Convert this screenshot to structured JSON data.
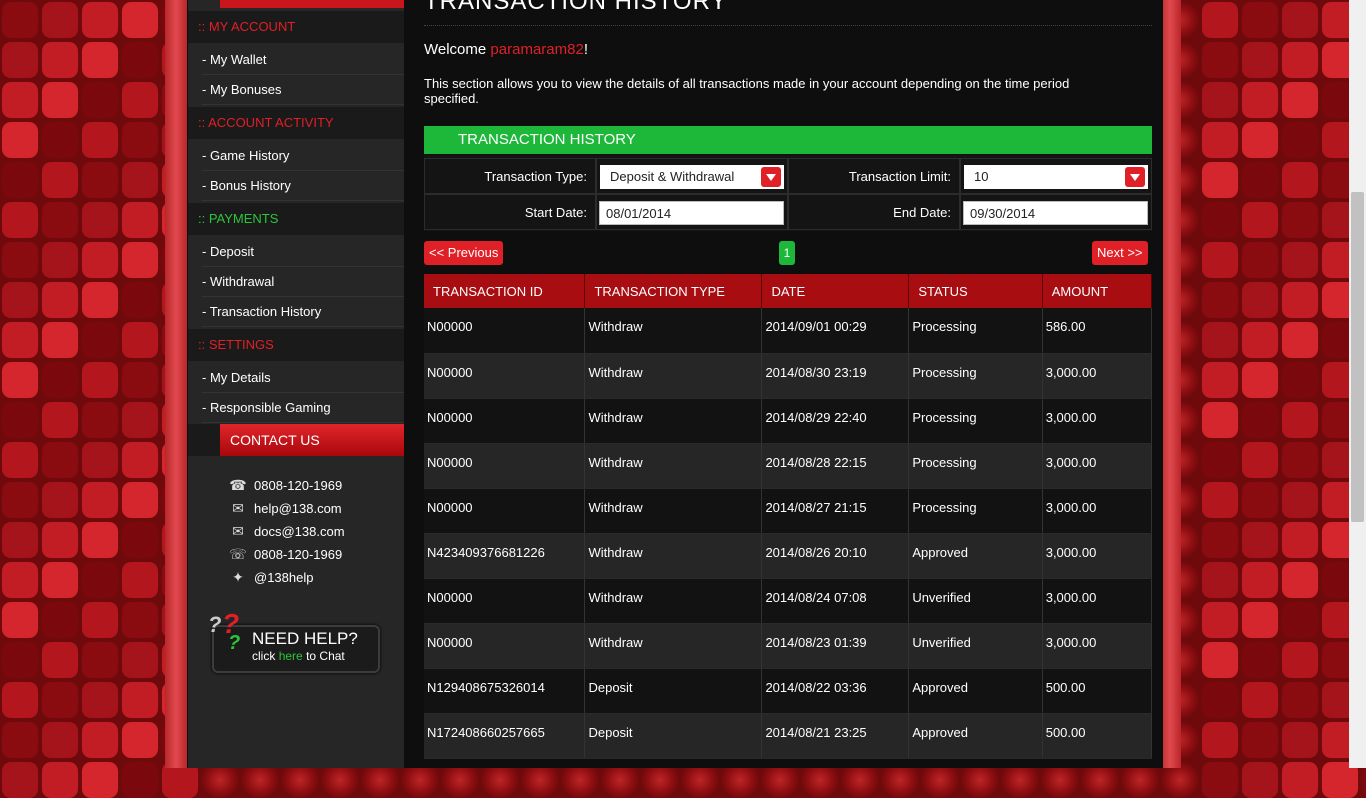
{
  "sidebar": {
    "sections": [
      {
        "title": ":: MY ACCOUNT",
        "items": [
          "- My Wallet",
          "- My Bonuses"
        ]
      },
      {
        "title": ":: ACCOUNT ACTIVITY",
        "items": [
          "- Game History",
          "- Bonus History"
        ]
      },
      {
        "title": ":: PAYMENTS",
        "items": [
          "- Deposit",
          "- Withdrawal",
          "- Transaction History"
        ]
      },
      {
        "title": ":: SETTINGS",
        "items": [
          "- My Details",
          "- Responsible Gaming"
        ]
      }
    ],
    "contact": {
      "title": "CONTACT US",
      "phone": "0808-120-1969",
      "email": "help@138.com",
      "docs": "docs@138.com",
      "fax": "0808-120-1969",
      "twitter": "@138help"
    },
    "help": {
      "title": "NEED HELP?",
      "click": "click",
      "here": "here",
      "to_chat": "to Chat"
    }
  },
  "main": {
    "title": "TRANSACTION HISTORY",
    "welcome_prefix": "Welcome",
    "username": "paramaram82",
    "welcome_suffix": "!",
    "description": "This section allows you to view the details of all transactions made in your account depending on the time period specified.",
    "panel_title": "TRANSACTION HISTORY",
    "filters": {
      "type_label": "Transaction Type:",
      "type_value": "Deposit & Withdrawal",
      "limit_label": "Transaction Limit:",
      "limit_value": "10",
      "start_label": "Start Date:",
      "start_value": "08/01/2014",
      "end_label": "End Date:",
      "end_value": "09/30/2014"
    },
    "pager": {
      "prev": "<< Previous",
      "page": "1",
      "next": "Next >>"
    },
    "table": {
      "headers": [
        "TRANSACTION ID",
        "TRANSACTION TYPE",
        "DATE",
        "STATUS",
        "AMOUNT"
      ],
      "rows": [
        [
          "N00000",
          "Withdraw",
          "2014/09/01 00:29",
          "Processing",
          "586.00"
        ],
        [
          "N00000",
          "Withdraw",
          "2014/08/30 23:19",
          "Processing",
          "3,000.00"
        ],
        [
          "N00000",
          "Withdraw",
          "2014/08/29 22:40",
          "Processing",
          "3,000.00"
        ],
        [
          "N00000",
          "Withdraw",
          "2014/08/28 22:15",
          "Processing",
          "3,000.00"
        ],
        [
          "N00000",
          "Withdraw",
          "2014/08/27 21:15",
          "Processing",
          "3,000.00"
        ],
        [
          "N423409376681226",
          "Withdraw",
          "2014/08/26 20:10",
          "Approved",
          "3,000.00"
        ],
        [
          "N00000",
          "Withdraw",
          "2014/08/24 07:08",
          "Unverified",
          "3,000.00"
        ],
        [
          "N00000",
          "Withdraw",
          "2014/08/23 01:39",
          "Unverified",
          "3,000.00"
        ],
        [
          "N129408675326014",
          "Deposit",
          "2014/08/22 03:36",
          "Approved",
          "500.00"
        ],
        [
          "N172408660257665",
          "Deposit",
          "2014/08/21 23:25",
          "Approved",
          "500.00"
        ]
      ]
    }
  },
  "colors": {
    "accent_red": "#e02027",
    "accent_green": "#1db83a",
    "header_red": "#a80d12"
  }
}
